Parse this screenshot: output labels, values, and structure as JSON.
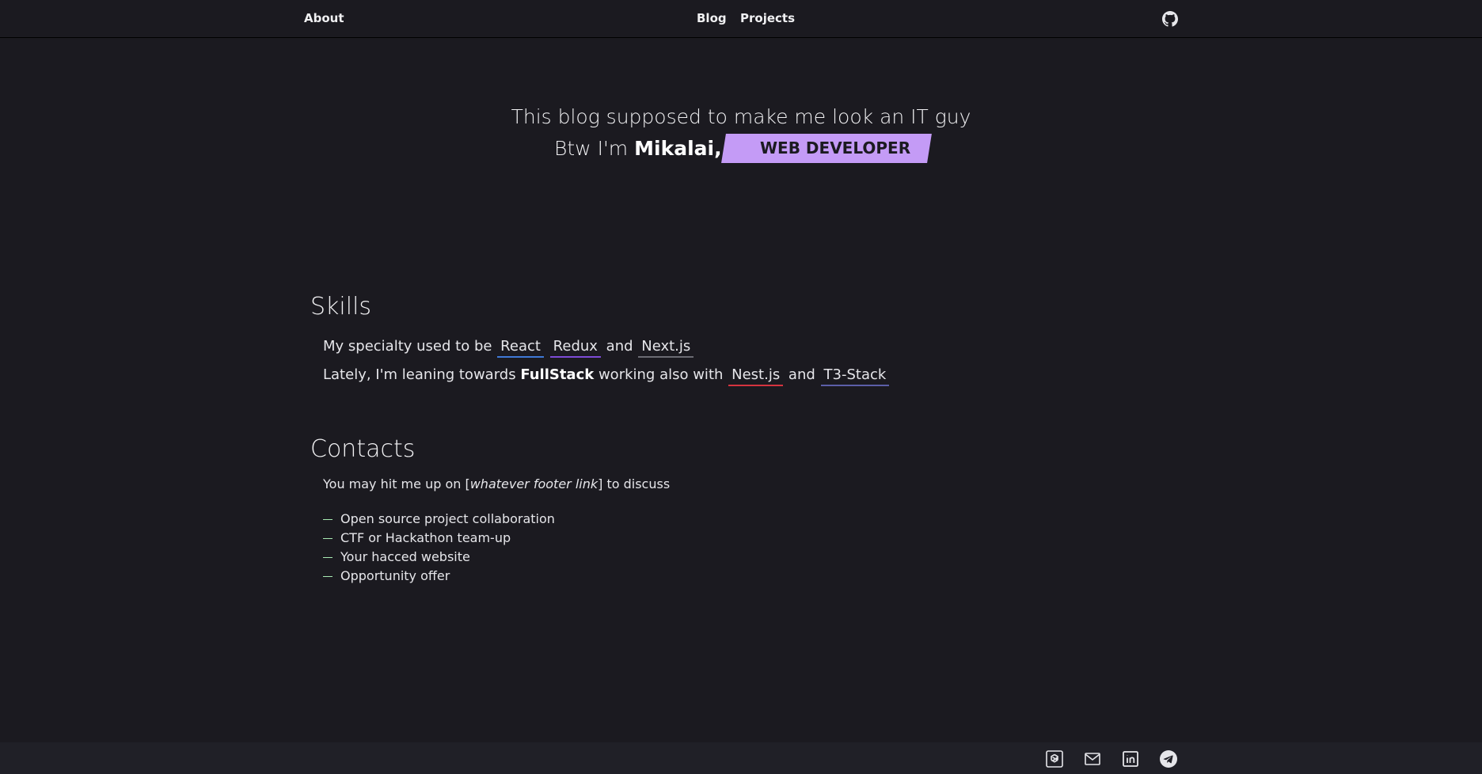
{
  "nav": {
    "about": "About",
    "blog": "Blog",
    "projects": "Projects"
  },
  "hero": {
    "line1": "This blog supposed to make me look an IT guy",
    "intro": "Btw I'm ",
    "name": "Mikalai, the",
    "role": "WEB DEVELOPER",
    "role_color": "#c49bf6"
  },
  "skills": {
    "title": "Skills",
    "line1_prefix": "My specialty used to be ",
    "line1_and": " and ",
    "line2_prefix": "Lately, I'm leaning towards ",
    "line2_strong": "FullStack",
    "line2_middle": " working also with ",
    "line2_and": " and ",
    "techs": [
      {
        "label": "React",
        "color": "#3f78d6"
      },
      {
        "label": "Redux",
        "color": "#7e4bd6"
      },
      {
        "label": "Next.js",
        "color": "#6b6b73"
      },
      {
        "label": "Nest.js",
        "color": "#d6343f"
      },
      {
        "label": "T3-Stack",
        "color": "#5c5fa8"
      }
    ]
  },
  "contacts": {
    "title": "Contacts",
    "intro_prefix": "You may hit me up on [",
    "intro_em": "whatever footer link",
    "intro_suffix": "] to discuss",
    "items": [
      "Open source project collaboration",
      "CTF or Hackathon team-up",
      "Your hacced website",
      "Opportunity offer"
    ]
  },
  "icons": {
    "github": "github-icon",
    "footer": [
      "openai-icon",
      "mail-icon",
      "linkedin-icon",
      "telegram-icon"
    ]
  },
  "colors": {
    "background": "#1b1a20",
    "footer_background": "#202027",
    "accent": "#c49bf6",
    "list_dash": "#a8ebb3"
  }
}
